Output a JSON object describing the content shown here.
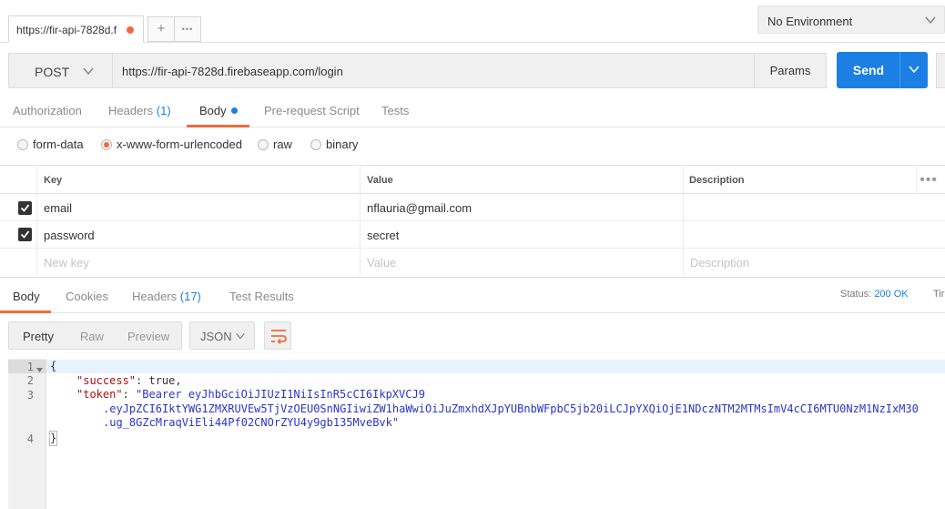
{
  "tab": {
    "title": "https://fir-api-7828d.f",
    "add": "+",
    "more": "•••"
  },
  "environment": {
    "selected": "No Environment"
  },
  "request": {
    "method": "POST",
    "url": "https://fir-api-7828d.firebaseapp.com/login",
    "params_label": "Params",
    "send_label": "Send"
  },
  "subtabs": [
    {
      "label": "Authorization"
    },
    {
      "label": "Headers",
      "count": "(1)"
    },
    {
      "label": "Body"
    },
    {
      "label": "Pre-request Script"
    },
    {
      "label": "Tests"
    }
  ],
  "body_types": [
    "form-data",
    "x-www-form-urlencoded",
    "raw",
    "binary"
  ],
  "body_type_selected": "x-www-form-urlencoded",
  "kv_table": {
    "headers": {
      "key": "Key",
      "value": "Value",
      "description": "Description"
    },
    "rows": [
      {
        "key": "email",
        "value": "nflauria@gmail.com",
        "checked": true
      },
      {
        "key": "password",
        "value": "secret",
        "checked": true
      }
    ],
    "placeholders": {
      "key": "New key",
      "value": "Value",
      "description": "Description"
    }
  },
  "response": {
    "tabs": [
      {
        "label": "Body"
      },
      {
        "label": "Cookies"
      },
      {
        "label": "Headers",
        "count": "(17)"
      },
      {
        "label": "Test Results"
      }
    ],
    "status_label": "Status:",
    "status_value": "200 OK",
    "time_label": "Tir",
    "format_buttons": [
      "Pretty",
      "Raw",
      "Preview"
    ],
    "format_selected": "Pretty",
    "language": "JSON",
    "line_numbers": [
      "1",
      "2",
      "3",
      "4"
    ],
    "code": {
      "open_brace": "{",
      "success_key": "\"success\"",
      "success_value": "true",
      "token_key": "\"token\"",
      "token_line1": "\"Bearer eyJhbGciOiJIUzI1NiIsInR5cCI6IkpXVCJ9",
      "token_line2": ".eyJpZCI6IktYWG1ZMXRUVEw5TjVzOEU0SnNGIiwiZW1haWwiOiJuZmxhdXJpYUBnbWFpbC5jb20iLCJpYXQiOjE1NDczNTM2MTMsImV4cCI6MTU0NzM1NzIxM30",
      "token_line3": ".ug_8GZcMraqViEli44Pf02CNOrZYU4y9gb135MveBvk\"",
      "close_brace": "}"
    }
  },
  "colors": {
    "accent": "#f26b3a",
    "primary": "#1b7fe3"
  }
}
